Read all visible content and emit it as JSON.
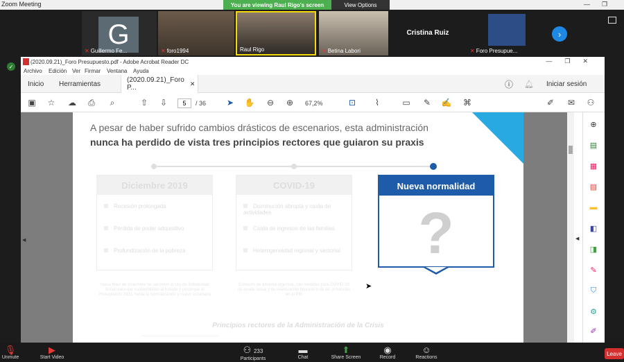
{
  "zoom": {
    "window_title": "Zoom Meeting",
    "viewing_banner": "You are viewing Raul Rigo's screen",
    "view_options": "View Options"
  },
  "gallery": {
    "tiles": [
      {
        "name": "Guillermo Fe...",
        "avatar_letter": "G"
      },
      {
        "name": "foro1994"
      },
      {
        "name": "Raul Rigo"
      },
      {
        "name": "Betina Labori"
      },
      {
        "name": "Cristina Ruiz"
      },
      {
        "name": "Foro Presupue..."
      }
    ]
  },
  "acrobat": {
    "title": "(2020.09.21)_Foro Presupuesto.pdf - Adobe Acrobat Reader DC",
    "menu": [
      "Archivo",
      "Edición",
      "Ver",
      "Firmar",
      "Ventana",
      "Ayuda"
    ],
    "tabs": {
      "home": "Inicio",
      "tools": "Herramientas",
      "doc": "(2020.09.21)_Foro P..."
    },
    "sign_in": "Iniciar sesión",
    "page_current": "5",
    "page_total": "/ 36",
    "zoom": "67,2%"
  },
  "slide": {
    "heading_line1": "A pesar de haber sufrido cambios drásticos de escenarios, esta administración",
    "heading_line2": "nunca ha perdido de vista tres principios rectores que guiaron su praxis",
    "progress_step": 3,
    "progress_total": 3,
    "cards": [
      {
        "title": "Diciembre 2019",
        "items": [
          "Recesión prolongada",
          "Pérdida de poder adquisitivo",
          "Profundización de la pobreza"
        ],
        "footnote": "Hacia fines de diciembre se sancionó la Ley de Solidaridad Social para dar sostenibilidad al Estado y postergar el Presupuesto 2020, hasta la normalización y nuevo escenario"
      },
      {
        "title": "COVID-19",
        "items": [
          "Disminución abrupta y caída de actividades",
          "Caída de ingresos de las familias",
          "Heterogeneidad regional y sectorial"
        ],
        "footnote": "Contexto de altísima urgencia, con medidas para COVID-19 de ayuda social y de reactivación financiera de las provincias en el PIB"
      },
      {
        "title": "Nueva normalidad",
        "symbol": "?"
      }
    ],
    "footer": "Principios rectores de la Administración de la Crisis"
  },
  "zoom_bar": {
    "items": [
      {
        "label": "Unmute",
        "icon": "mic-muted-icon"
      },
      {
        "label": "Start Video",
        "icon": "video-off-icon"
      },
      {
        "label": "Participants",
        "count": "233",
        "icon": "participants-icon"
      },
      {
        "label": "Chat",
        "icon": "chat-icon"
      },
      {
        "label": "Share Screen",
        "icon": "share-screen-icon"
      },
      {
        "label": "Record",
        "icon": "record-icon"
      },
      {
        "label": "Reactions",
        "icon": "reactions-icon"
      }
    ],
    "leave": "Leave"
  }
}
